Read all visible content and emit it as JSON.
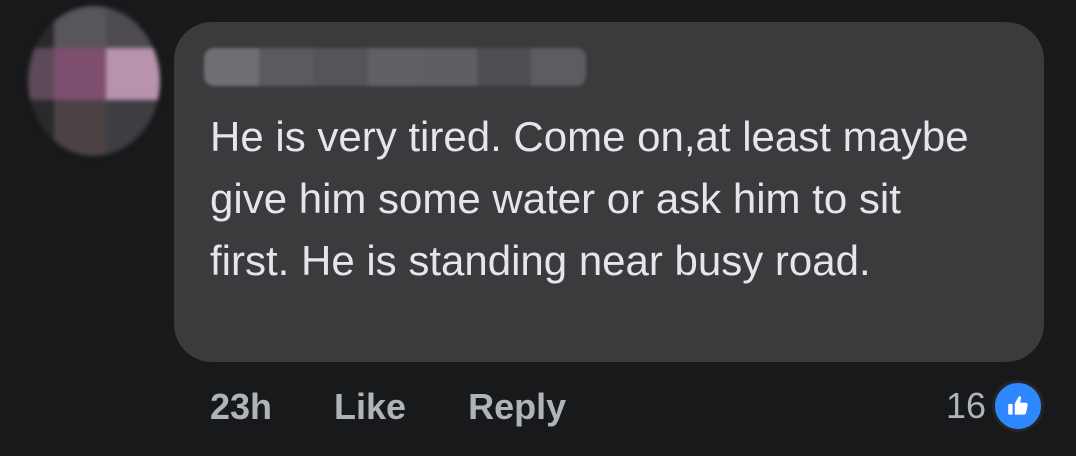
{
  "comment": {
    "text": "He is very tired. Come on,at least maybe give him some water or ask him to sit first. He is standing near busy road.",
    "author_redacted": true
  },
  "actions": {
    "timestamp": "23h",
    "like_label": "Like",
    "reply_label": "Reply"
  },
  "reactions": {
    "count": "16",
    "icon": "thumbs-up-icon",
    "icon_color": "#2d88ff"
  },
  "colors": {
    "background": "#18191a",
    "bubble": "#3a3b3c",
    "text": "#e4e6eb",
    "muted": "#b0b3b8",
    "accent": "#2d88ff"
  }
}
